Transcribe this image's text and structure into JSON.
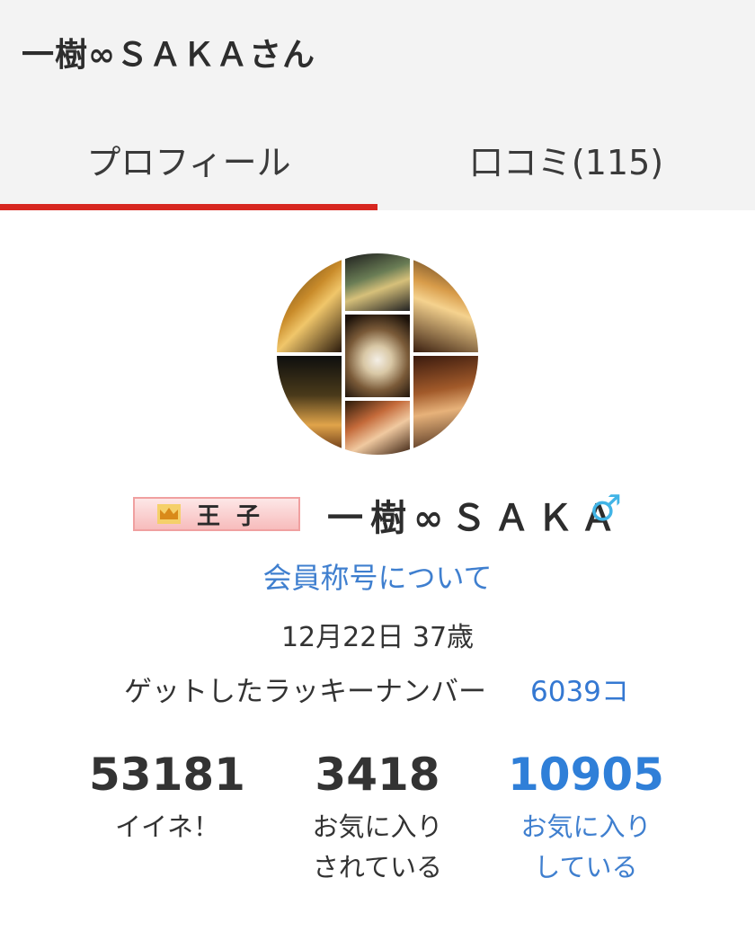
{
  "header": {
    "title": "一樹∞ＳＡＫＡさん"
  },
  "tabs": [
    {
      "label": "プロフィール",
      "active": true
    },
    {
      "label": "口コミ(115)",
      "active": false
    }
  ],
  "colors": {
    "accent": "#d7261f",
    "link": "#3f7fcf",
    "gender": "#41b4e6",
    "badge": "#f7bcbc"
  },
  "profile": {
    "avatar_icon": "photo-collage-avatar",
    "rank_badge": "王子",
    "username": "一樹∞ＳＡＫＡ",
    "gender_icon": "♂",
    "title_link": "会員称号について",
    "birth_age": "12月22日 37歳",
    "lucky_number_label": "ゲットしたラッキーナンバー",
    "lucky_number_value": "6039コ"
  },
  "stats": [
    {
      "value": "53181",
      "label_line1": "イイネ！",
      "label_line2": ""
    },
    {
      "value": "3418",
      "label_line1": "お気に入り",
      "label_line2": "されている"
    },
    {
      "value": "10905",
      "label_line1": "お気に入り",
      "label_line2": "している"
    }
  ]
}
